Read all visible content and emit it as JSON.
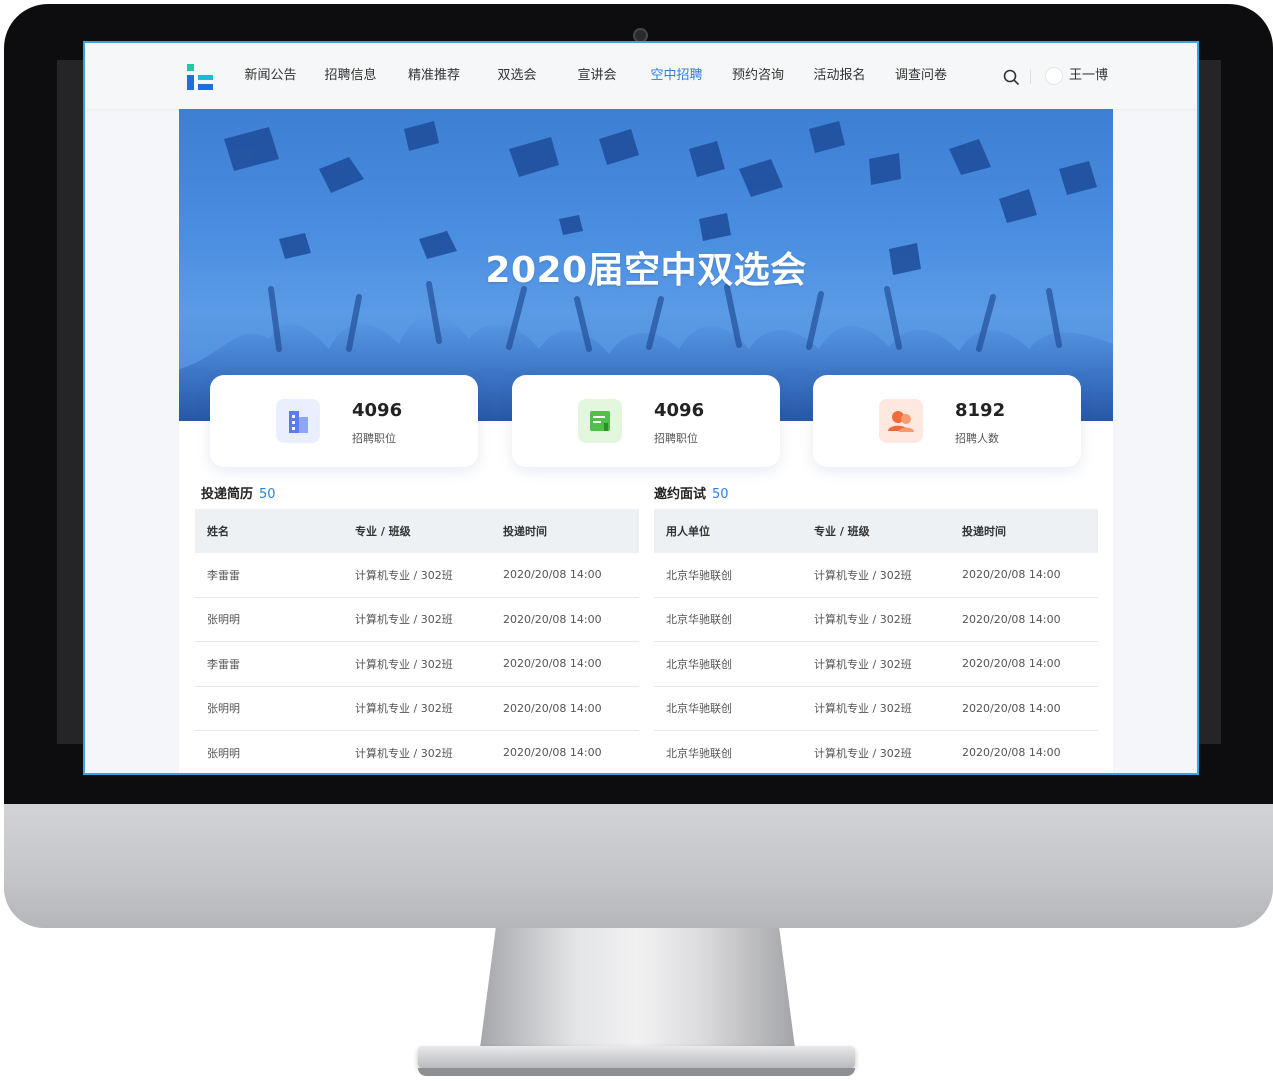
{
  "nav": {
    "items": [
      {
        "label": "新闻公告",
        "active": false
      },
      {
        "label": "招聘信息",
        "active": false
      },
      {
        "label": "精准推荐",
        "active": false
      },
      {
        "label": "双选会",
        "active": false
      },
      {
        "label": "宣讲会",
        "active": false
      },
      {
        "label": "空中招聘",
        "active": true
      },
      {
        "label": "预约咨询",
        "active": false
      },
      {
        "label": "活动报名",
        "active": false
      },
      {
        "label": "调查问卷",
        "active": false
      }
    ],
    "user_name": "王一博"
  },
  "banner": {
    "title": "2020届空中双选会"
  },
  "stats": [
    {
      "value": "4096",
      "label": "招聘职位",
      "icon": "building-icon",
      "color": "#5b7cf0"
    },
    {
      "value": "4096",
      "label": "招聘职位",
      "icon": "document-icon",
      "color": "#4fc04a"
    },
    {
      "value": "8192",
      "label": "招聘人数",
      "icon": "people-icon",
      "color": "#f06a3c"
    }
  ],
  "resumes": {
    "title": "投递简历",
    "count": "50",
    "headers": [
      "姓名",
      "专业 / 班级",
      "投递时间"
    ],
    "rows": [
      [
        "李雷雷",
        "计算机专业 / 302班",
        "2020/20/08 14:00"
      ],
      [
        "张明明",
        "计算机专业 / 302班",
        "2020/20/08 14:00"
      ],
      [
        "李雷雷",
        "计算机专业 / 302班",
        "2020/20/08 14:00"
      ],
      [
        "张明明",
        "计算机专业 / 302班",
        "2020/20/08 14:00"
      ],
      [
        "张明明",
        "计算机专业 / 302班",
        "2020/20/08 14:00"
      ]
    ]
  },
  "interviews": {
    "title": "邀约面试",
    "count": "50",
    "headers": [
      "用人单位",
      "专业 / 班级",
      "投递时间"
    ],
    "rows": [
      [
        "北京华驰联创",
        "计算机专业 / 302班",
        "2020/20/08 14:00"
      ],
      [
        "北京华驰联创",
        "计算机专业 / 302班",
        "2020/20/08 14:00"
      ],
      [
        "北京华驰联创",
        "计算机专业 / 302班",
        "2020/20/08 14:00"
      ],
      [
        "北京华驰联创",
        "计算机专业 / 302班",
        "2020/20/08 14:00"
      ],
      [
        "北京华驰联创",
        "计算机专业 / 302班",
        "2020/20/08 14:00"
      ]
    ]
  },
  "colors": {
    "accent": "#2d7fe0",
    "banner": "#4a8ee0",
    "frame_highlight": "#3aa2dc"
  }
}
